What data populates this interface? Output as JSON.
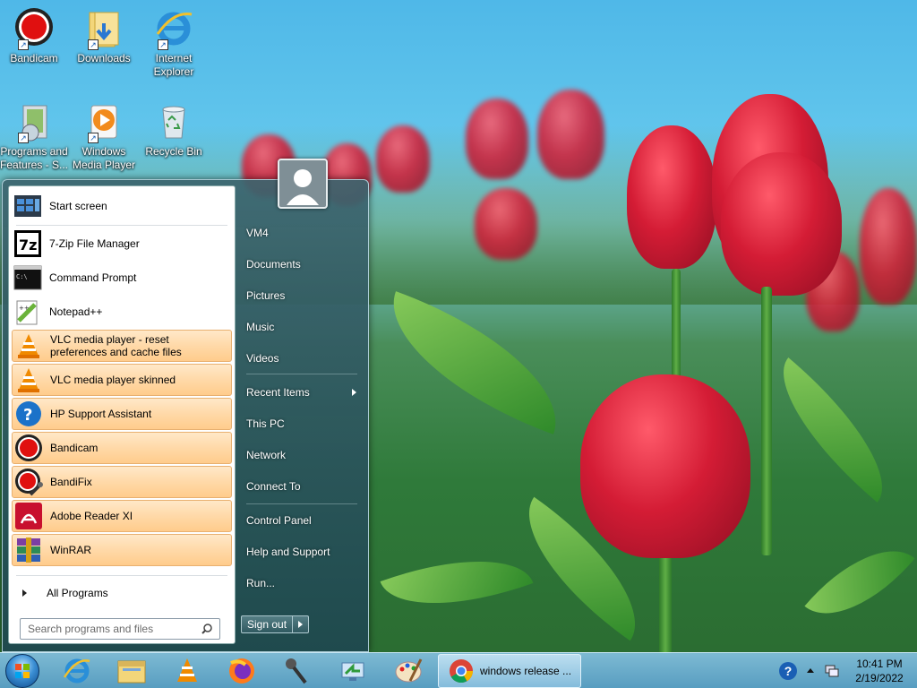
{
  "desktop": {
    "icons": [
      {
        "label": "Bandicam",
        "icon": "bandicam-icon"
      },
      {
        "label": "Downloads",
        "icon": "downloads-folder-icon"
      },
      {
        "label": "Internet\nExplorer",
        "icon": "internet-explorer-icon"
      },
      {
        "label": "Programs and\nFeatures - S...",
        "icon": "programs-features-icon"
      },
      {
        "label": "Windows\nMedia Player",
        "icon": "media-player-icon"
      },
      {
        "label": "Recycle Bin",
        "icon": "recycle-bin-icon"
      }
    ]
  },
  "start_menu": {
    "programs": [
      {
        "label": "Start screen",
        "icon": "start-screen-icon",
        "pinned": false
      },
      {
        "label": "7-Zip File Manager",
        "icon": "7zip-icon",
        "pinned": false
      },
      {
        "label": "Command Prompt",
        "icon": "command-prompt-icon",
        "pinned": false
      },
      {
        "label": "Notepad++",
        "icon": "notepadpp-icon",
        "pinned": false
      },
      {
        "label": "VLC media player - reset\npreferences and cache files",
        "icon": "vlc-icon",
        "pinned": true
      },
      {
        "label": "VLC media player skinned",
        "icon": "vlc-icon",
        "pinned": true
      },
      {
        "label": "HP Support Assistant",
        "icon": "hp-support-icon",
        "pinned": true
      },
      {
        "label": "Bandicam",
        "icon": "bandicam-icon",
        "pinned": true
      },
      {
        "label": "BandiFix",
        "icon": "bandifix-icon",
        "pinned": true
      },
      {
        "label": "Adobe Reader XI",
        "icon": "adobe-reader-icon",
        "pinned": true
      },
      {
        "label": "WinRAR",
        "icon": "winrar-icon",
        "pinned": true
      }
    ],
    "all_programs": "All Programs",
    "search_placeholder": "Search programs and files",
    "right_items": [
      {
        "label": "VM4"
      },
      {
        "label": "Documents"
      },
      {
        "label": "Pictures"
      },
      {
        "label": "Music"
      },
      {
        "label": "Videos"
      },
      {
        "label": "Recent Items",
        "submenu": true
      },
      {
        "label": "This PC"
      },
      {
        "label": "Network"
      },
      {
        "label": "Connect To"
      },
      {
        "label": "Control Panel"
      },
      {
        "label": "Help and Support"
      },
      {
        "label": "Run..."
      }
    ],
    "sign_out": "Sign out"
  },
  "taskbar": {
    "pinned": [
      "internet-explorer-icon",
      "file-explorer-icon",
      "vlc-icon",
      "firefox-icon",
      "microphone-icon",
      "remote-desktop-icon",
      "paint-icon"
    ],
    "active_task": {
      "label": "windows release ...",
      "icon": "chrome-icon"
    },
    "tray": {
      "help": "?",
      "time": "10:41 PM",
      "date": "2/19/2022"
    }
  },
  "colors": {
    "pinned_bg": "#ffd9a8",
    "taskbar": "#6fb0d8",
    "menu_glass": "#2f5a66"
  }
}
